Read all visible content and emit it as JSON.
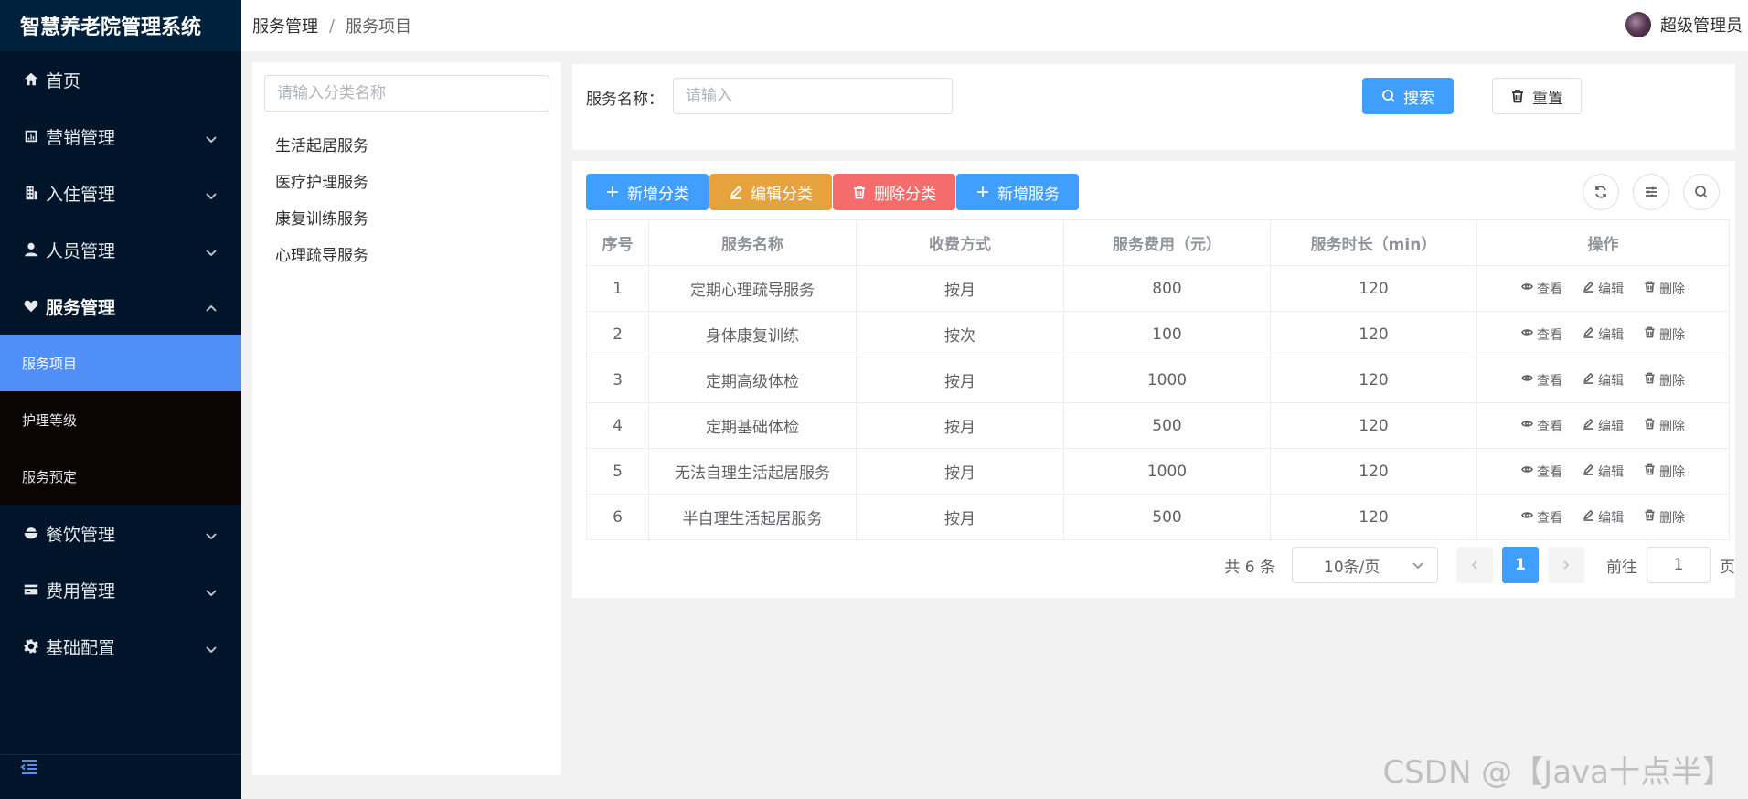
{
  "app": {
    "title": "智慧养老院管理系统"
  },
  "sidebar": {
    "items": [
      {
        "label": "首页",
        "icon": "home-icon",
        "expandable": false
      },
      {
        "label": "营销管理",
        "icon": "chart-icon",
        "expandable": true
      },
      {
        "label": "入住管理",
        "icon": "building-icon",
        "expandable": true
      },
      {
        "label": "人员管理",
        "icon": "user-icon",
        "expandable": true
      },
      {
        "label": "服务管理",
        "icon": "heart-hand-icon",
        "expandable": true,
        "open": true,
        "children": [
          {
            "label": "服务项目",
            "active": true
          },
          {
            "label": "护理等级",
            "active": false
          },
          {
            "label": "服务预定",
            "active": false
          }
        ]
      },
      {
        "label": "餐饮管理",
        "icon": "bowl-icon",
        "expandable": true
      },
      {
        "label": "费用管理",
        "icon": "card-icon",
        "expandable": true
      },
      {
        "label": "基础配置",
        "icon": "gear-icon",
        "expandable": true
      }
    ]
  },
  "header": {
    "breadcrumb": [
      "服务管理",
      "服务项目"
    ],
    "separator": "/",
    "user": "超级管理员"
  },
  "category": {
    "placeholder": "请输入分类名称",
    "items": [
      "生活起居服务",
      "医疗护理服务",
      "康复训练服务",
      "心理疏导服务"
    ]
  },
  "search": {
    "label": "服务名称：",
    "placeholder": "请输入",
    "search_label": "搜索",
    "reset_label": "重置"
  },
  "toolbar": {
    "add_category": "新增分类",
    "edit_category": "编辑分类",
    "delete_category": "删除分类",
    "add_service": "新增服务"
  },
  "table": {
    "columns": [
      "序号",
      "服务名称",
      "收费方式",
      "服务费用（元）",
      "服务时长（min）",
      "操作"
    ],
    "rows": [
      {
        "no": "1",
        "name": "定期心理疏导服务",
        "mode": "按月",
        "fee": "800",
        "duration": "120"
      },
      {
        "no": "2",
        "name": "身体康复训练",
        "mode": "按次",
        "fee": "100",
        "duration": "120"
      },
      {
        "no": "3",
        "name": "定期高级体检",
        "mode": "按月",
        "fee": "1000",
        "duration": "120"
      },
      {
        "no": "4",
        "name": "定期基础体检",
        "mode": "按月",
        "fee": "500",
        "duration": "120"
      },
      {
        "no": "5",
        "name": "无法自理生活起居服务",
        "mode": "按月",
        "fee": "1000",
        "duration": "120"
      },
      {
        "no": "6",
        "name": "半自理生活起居服务",
        "mode": "按月",
        "fee": "500",
        "duration": "120"
      }
    ],
    "actions": {
      "view": "查看",
      "edit": "编辑",
      "delete": "删除"
    }
  },
  "pagination": {
    "total": "共 6 条",
    "page_size": "10条/页",
    "current_page": "1",
    "goto_label": "前往",
    "goto_value": "1",
    "goto_suffix": "页"
  },
  "watermark": "CSDN @【Java十点半】",
  "colors": {
    "primary": "#409eff",
    "warning": "#e6a23c",
    "danger": "#f56c6c",
    "sidebar_bg": "#001529",
    "active_menu": "#4f8ff7"
  }
}
